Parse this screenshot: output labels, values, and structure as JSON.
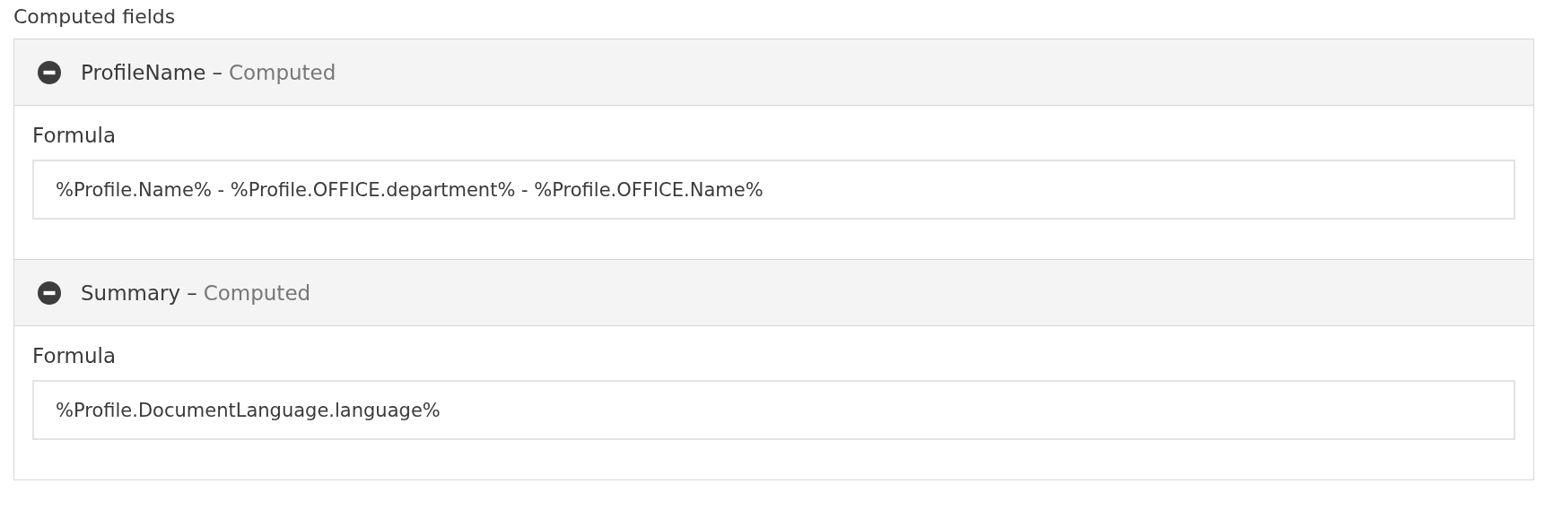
{
  "title": "Computed fields",
  "fields": [
    {
      "name": "ProfileName",
      "separator": "–",
      "type": "Computed",
      "expanded": true,
      "formula_label": "Formula",
      "formula": "%Profile.Name% - %Profile.OFFICE.department% - %Profile.OFFICE.Name%"
    },
    {
      "name": "Summary",
      "separator": "–",
      "type": "Computed",
      "expanded": true,
      "formula_label": "Formula",
      "formula": "%Profile.DocumentLanguage.language%"
    }
  ]
}
